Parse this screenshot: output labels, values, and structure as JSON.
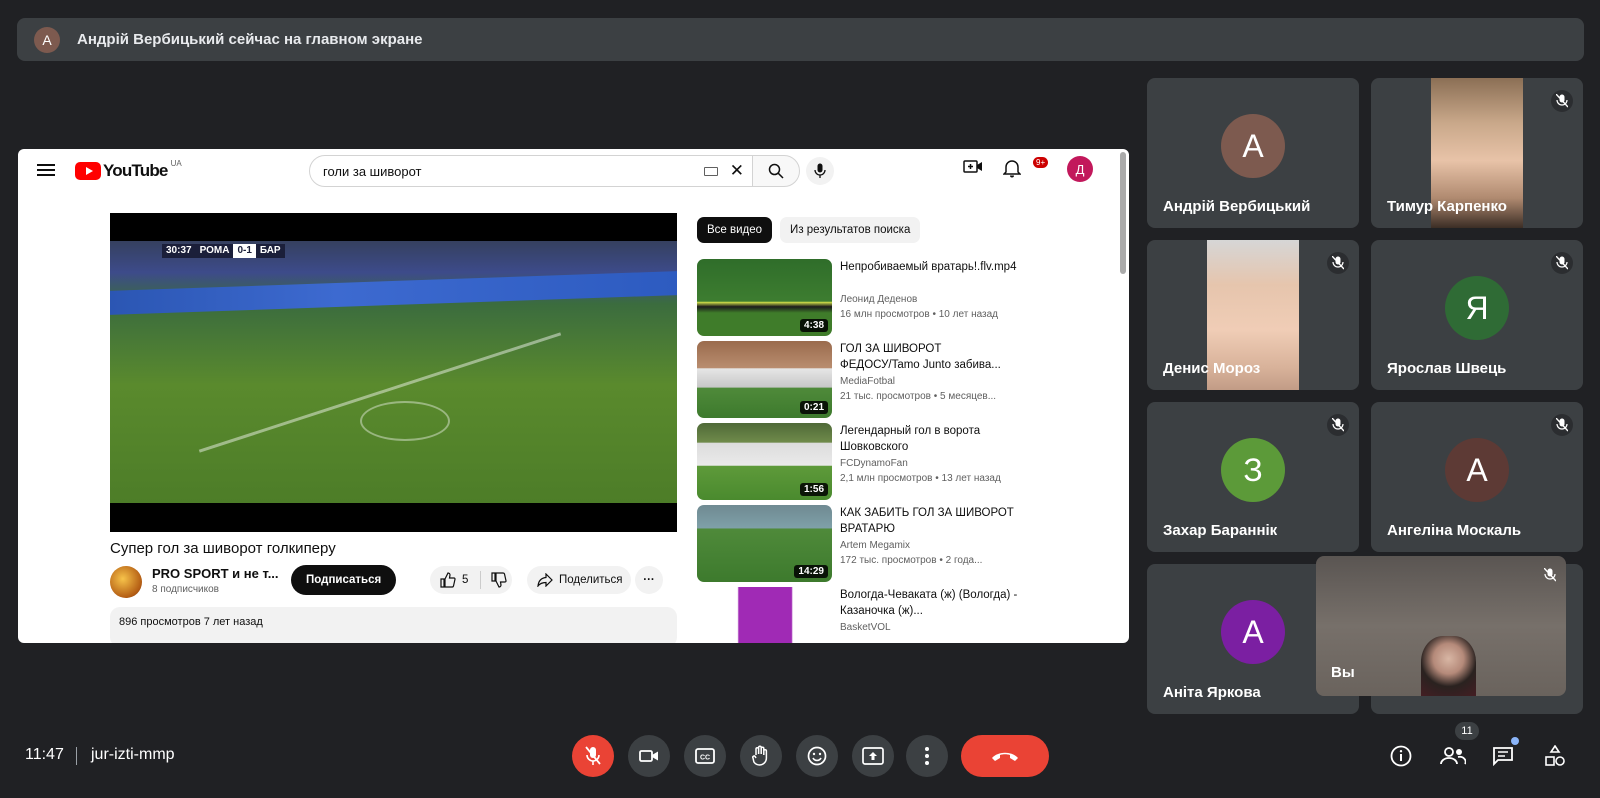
{
  "banner": {
    "avatar_letter": "А",
    "text": "Андрій Вербицький сейчас на главном экране"
  },
  "youtube": {
    "logo": "YouTube",
    "region": "UA",
    "search_query": "голи за шиворот",
    "notif_badge": "9+",
    "avatar_letter": "Д",
    "player": {
      "score_time": "30:37",
      "home": "РОМА",
      "score": "0-1",
      "away": "БАР"
    },
    "video_title": "Супер гол за шиворот голкиперу",
    "channel_name": "PRO SPORT и не т...",
    "channel_subs": "8 подписчиков",
    "subscribe_label": "Подписаться",
    "likes": "5",
    "share_label": "Поделиться",
    "info_text": "896 просмотров  7 лет назад",
    "chips": [
      "Все видео",
      "Из результатов поиска"
    ],
    "recs": [
      {
        "title": "Непробиваемый вратарь!.flv.mp4",
        "channel": "Леонид Деденов",
        "views": "16 млн просмотров • 10 лет назад",
        "duration": "4:38"
      },
      {
        "title": "ГОЛ ЗА ШИВОРОТ ФЕДОСУ/Tamo Junto забива...",
        "channel": "MediaFotbal",
        "views": "21 тыс. просмотров • 5 месяцев...",
        "duration": "0:21"
      },
      {
        "title": "Легендарный гол в ворота Шовковского",
        "channel": "FCDynamoFan",
        "views": "2,1 млн просмотров • 13 лет назад",
        "duration": "1:56"
      },
      {
        "title": "КАК ЗАБИТЬ ГОЛ ЗА ШИВОРОТ ВРАТАРЮ",
        "channel": "Artem Megamix",
        "views": "172 тыс. просмотров • 2 года...",
        "duration": "14:29"
      },
      {
        "title": "Вологда-Чеваката (ж) (Вологда) - Казаночка (ж)...",
        "channel": "BasketVOL",
        "views": "",
        "duration": ""
      }
    ]
  },
  "participants": [
    {
      "name": "Андрій Вербицький",
      "letter": "А",
      "color": "#7d5a4f",
      "muted": false,
      "photo": false
    },
    {
      "name": "Тимур Карпенко",
      "letter": "",
      "color": "",
      "muted": true,
      "photo": true
    },
    {
      "name": "Денис Мороз",
      "letter": "",
      "color": "",
      "muted": true,
      "photo": true
    },
    {
      "name": "Ярослав Швець",
      "letter": "Я",
      "color": "#2f6b35",
      "muted": true,
      "photo": false
    },
    {
      "name": "Захар Бараннік",
      "letter": "З",
      "color": "#5c9a39",
      "muted": true,
      "photo": false
    },
    {
      "name": "Ангеліна Москаль",
      "letter": "А",
      "color": "#5d3a35",
      "muted": true,
      "photo": false
    },
    {
      "name": "Аніта Яркова",
      "letter": "А",
      "color": "#7b1fa2",
      "muted": false,
      "photo": false
    },
    {
      "name": "Вы",
      "letter": "",
      "color": "",
      "muted": true,
      "photo": true
    }
  ],
  "bottom": {
    "time": "11:47",
    "meeting_code": "jur-izti-mmp",
    "participant_count": "11"
  }
}
